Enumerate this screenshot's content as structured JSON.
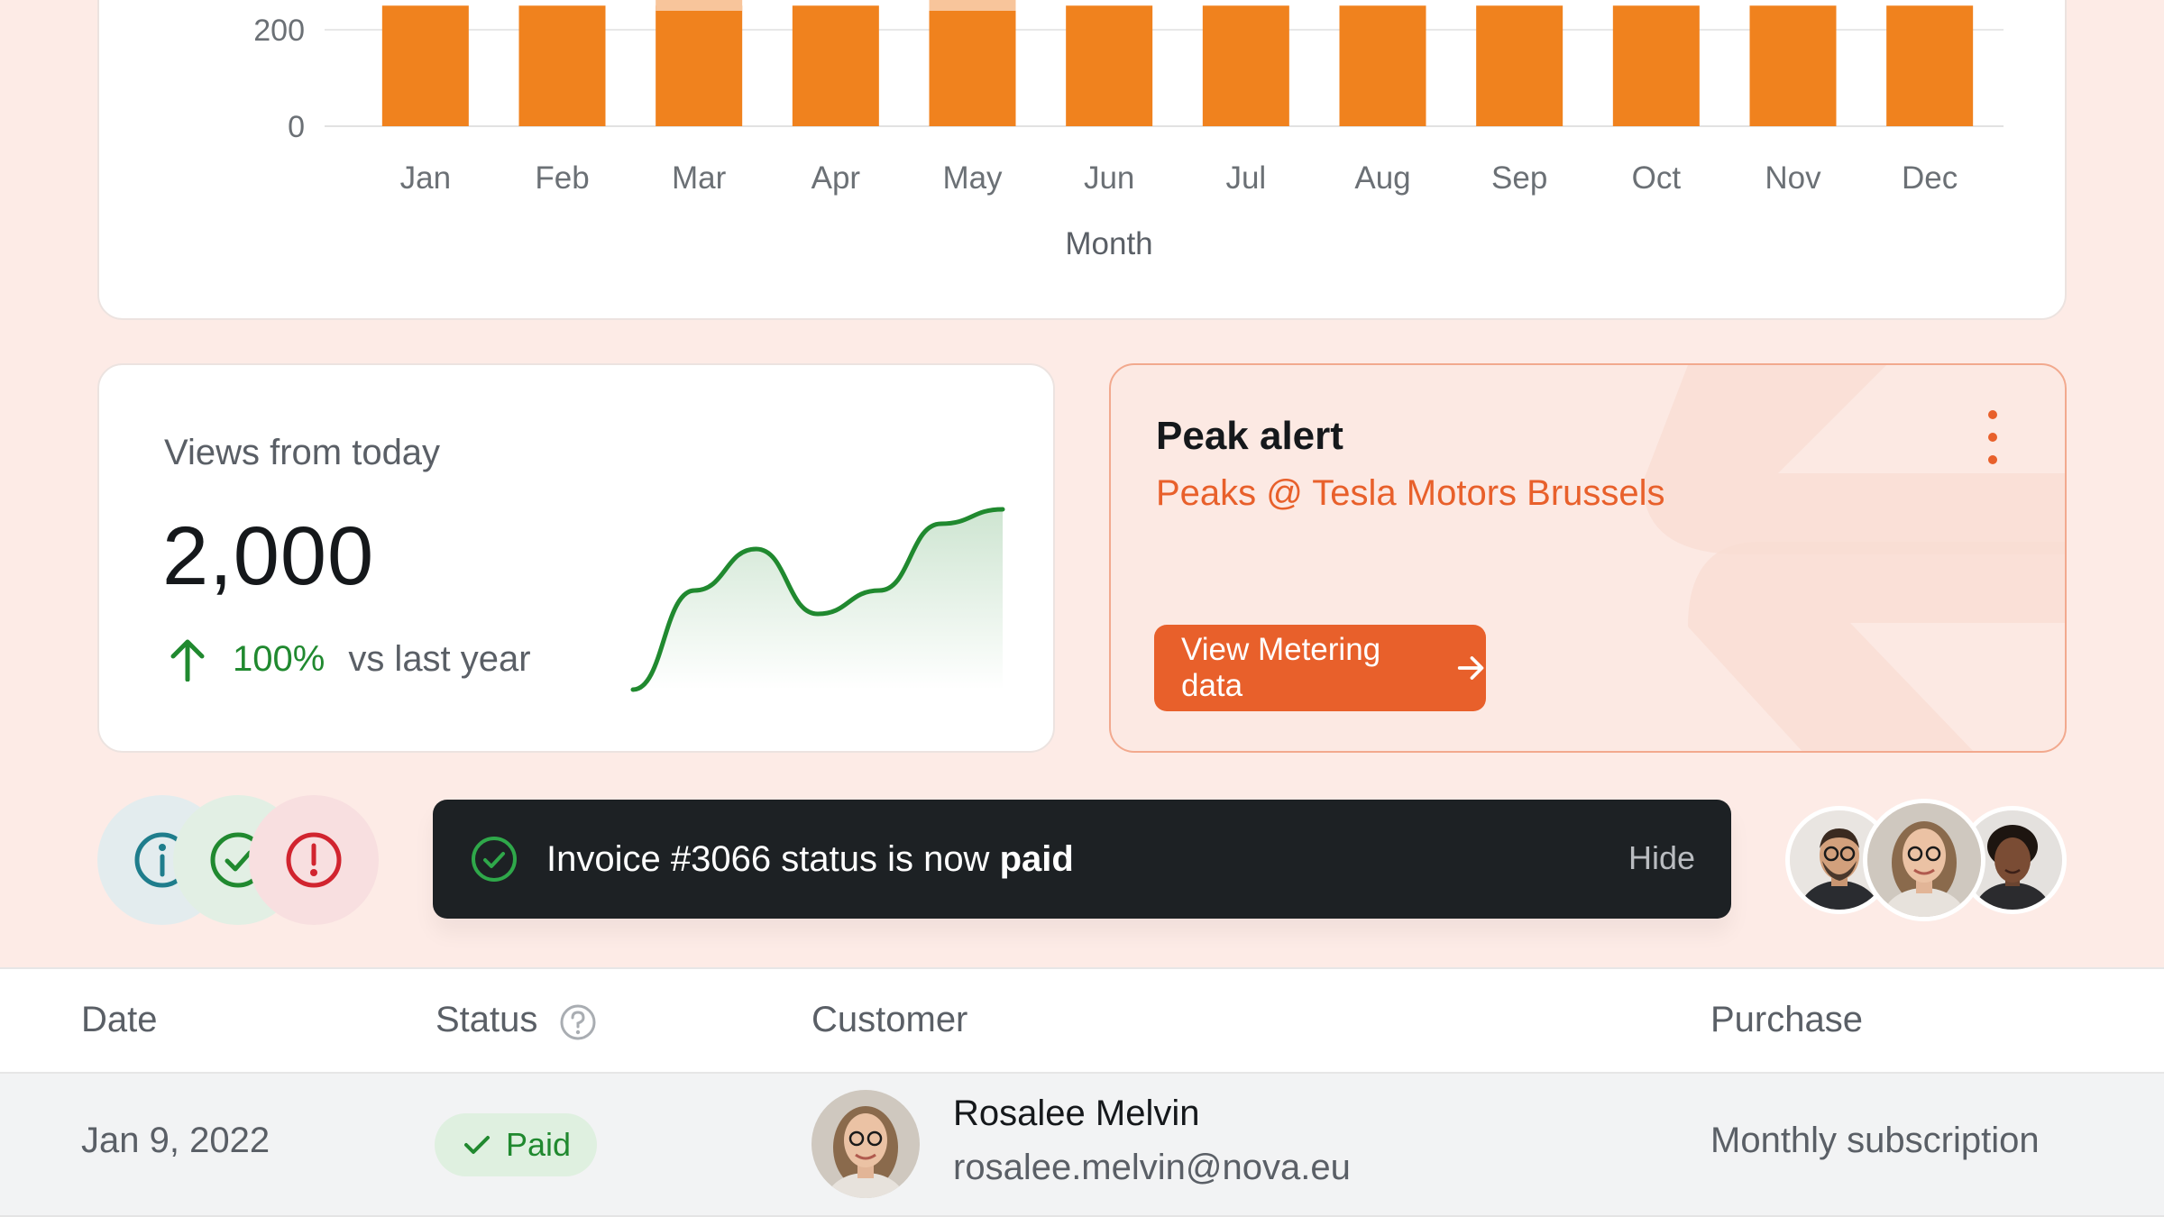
{
  "chart_data": {
    "type": "bar",
    "categories": [
      "Jan",
      "Feb",
      "Mar",
      "Apr",
      "May",
      "Jun",
      "Jul",
      "Aug",
      "Sep",
      "Oct",
      "Nov",
      "Dec"
    ],
    "yticks": [
      "0",
      "200"
    ],
    "ylim": [
      0,
      250
    ],
    "xlabel": "Month",
    "values": [
      250,
      250,
      250,
      250,
      250,
      250,
      250,
      250,
      250,
      250,
      250,
      250
    ],
    "color": "#f0821e",
    "highlight_color": "#f8c59b"
  },
  "views": {
    "title": "Views from today",
    "value": "2,000",
    "percent": "100%",
    "comparison": "vs last year",
    "sparkline": [
      0.0,
      0.55,
      0.78,
      0.42,
      0.55,
      0.92,
      1.0
    ],
    "trend_color": "#20892f"
  },
  "peak": {
    "title": "Peak alert",
    "subtitle": "Peaks @ Tesla Motors Brussels",
    "button_label": "View Metering data",
    "menu_icon": "kebab-icon",
    "accent": "#e8602b"
  },
  "status_icons": [
    "info-icon",
    "check-circle-icon",
    "alert-icon"
  ],
  "toast": {
    "prefix": "Invoice",
    "invoice": "#3066",
    "middle": "status is now",
    "status": "paid",
    "hide_label": "Hide"
  },
  "table": {
    "headers": [
      "Date",
      "Status",
      "Customer",
      "Purchase"
    ],
    "rows": [
      {
        "date": "Jan 9, 2022",
        "status": "Paid",
        "name": "Rosalee Melvin",
        "email": "rosalee.melvin@nova.eu",
        "purchase": "Monthly subscription"
      }
    ]
  }
}
